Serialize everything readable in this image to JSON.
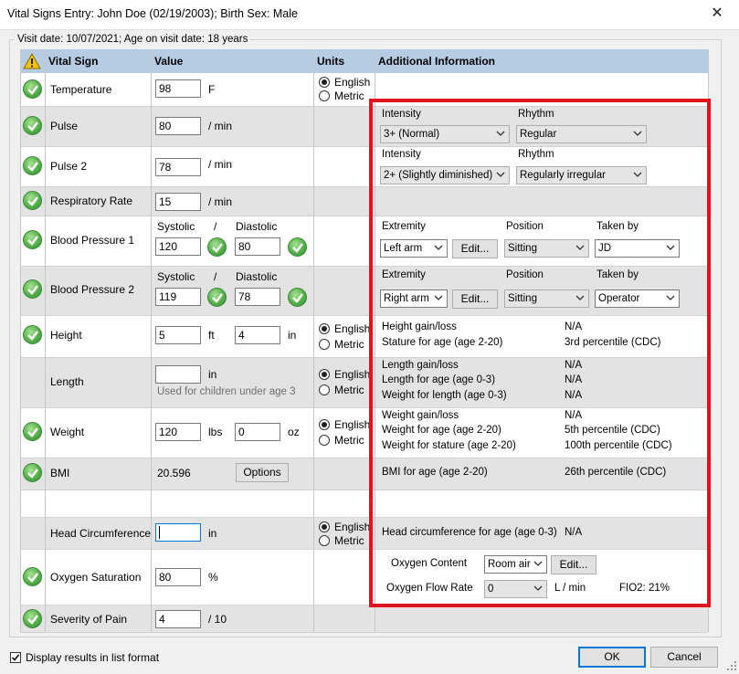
{
  "window": {
    "title": "Vital Signs Entry: John Doe (02/19/2003); Birth Sex: Male",
    "close_glyph": "✕"
  },
  "visit_info": "Visit date: 10/07/2021; Age on visit date: 18 years",
  "columns": {
    "vital_sign": "Vital Sign",
    "value": "Value",
    "units": "Units",
    "additional": "Additional Information"
  },
  "units": {
    "english": "English",
    "metric": "Metric"
  },
  "temperature": {
    "label": "Temperature",
    "value": "98",
    "unit": "F"
  },
  "pulse": {
    "label": "Pulse",
    "value": "80",
    "unit": "/ min",
    "intensity_label": "Intensity",
    "intensity": "3+ (Normal)",
    "rhythm_label": "Rhythm",
    "rhythm": "Regular"
  },
  "pulse2": {
    "label": "Pulse 2",
    "value": "78",
    "unit": "/ min",
    "intensity_label": "Intensity",
    "intensity": "2+ (Slightly diminished)",
    "rhythm_label": "Rhythm",
    "rhythm": "Regularly irregular"
  },
  "respiratory": {
    "label": "Respiratory Rate",
    "value": "15",
    "unit": "/ min"
  },
  "bp1": {
    "label": "Blood Pressure 1",
    "systolic_label": "Systolic",
    "slash": "/",
    "diastolic_label": "Diastolic",
    "systolic": "120",
    "diastolic": "80",
    "extremity_label": "Extremity",
    "extremity": "Left arm",
    "edit": "Edit...",
    "position_label": "Position",
    "position": "Sitting",
    "taken_by_label": "Taken by",
    "taken_by": "JD"
  },
  "bp2": {
    "label": "Blood Pressure 2",
    "systolic_label": "Systolic",
    "slash": "/",
    "diastolic_label": "Diastolic",
    "systolic": "119",
    "diastolic": "78",
    "extremity_label": "Extremity",
    "extremity": "Right arm",
    "edit": "Edit...",
    "position_label": "Position",
    "position": "Sitting",
    "taken_by_label": "Taken by",
    "taken_by": "Operator"
  },
  "height": {
    "label": "Height",
    "ft_value": "5",
    "ft_unit": "ft",
    "in_value": "4",
    "in_unit": "in",
    "info": [
      {
        "k": "Height gain/loss",
        "v": "N/A"
      },
      {
        "k": "Stature for age (age 2-20)",
        "v": "3rd percentile (CDC)"
      }
    ]
  },
  "length": {
    "label": "Length",
    "value": "",
    "unit": "in",
    "hint": "Used for children under age 3",
    "info": [
      {
        "k": "Length gain/loss",
        "v": "N/A"
      },
      {
        "k": "Length for age (age 0-3)",
        "v": "N/A"
      },
      {
        "k": "Weight for length (age 0-3)",
        "v": "N/A"
      }
    ]
  },
  "weight": {
    "label": "Weight",
    "lbs_value": "120",
    "lbs_unit": "lbs",
    "oz_value": "0",
    "oz_unit": "oz",
    "info": [
      {
        "k": "Weight gain/loss",
        "v": "N/A"
      },
      {
        "k": "Weight for age (age 2-20)",
        "v": "5th percentile (CDC)"
      },
      {
        "k": "Weight for stature (age 2-20)",
        "v": "100th percentile (CDC)"
      }
    ]
  },
  "bmi": {
    "label": "BMI",
    "value": "20.596",
    "options": "Options",
    "info_k": "BMI for age (age 2-20)",
    "info_v": "26th percentile (CDC)"
  },
  "head": {
    "label": "Head Circumference",
    "value": "",
    "unit": "in",
    "info_k": "Head circumference for age (age 0-3)",
    "info_v": "N/A"
  },
  "oxygen": {
    "label": "Oxygen Saturation",
    "value": "80",
    "unit": "%",
    "content_label": "Oxygen Content",
    "content": "Room air",
    "edit": "Edit...",
    "flow_label": "Oxygen Flow Rate",
    "flow": "0",
    "flow_unit": "L / min",
    "fio2": "FIO2:  21%"
  },
  "pain": {
    "label": "Severity of Pain",
    "value": "4",
    "unit": "/ 10"
  },
  "footer": {
    "list_format": "Display results in list format",
    "ok": "OK",
    "cancel": "Cancel"
  },
  "colors": {
    "header_bg": "#b6cce3",
    "band_bg": "#e3e3e3",
    "highlight": "#e0141e",
    "check_green": "#55b04a"
  }
}
